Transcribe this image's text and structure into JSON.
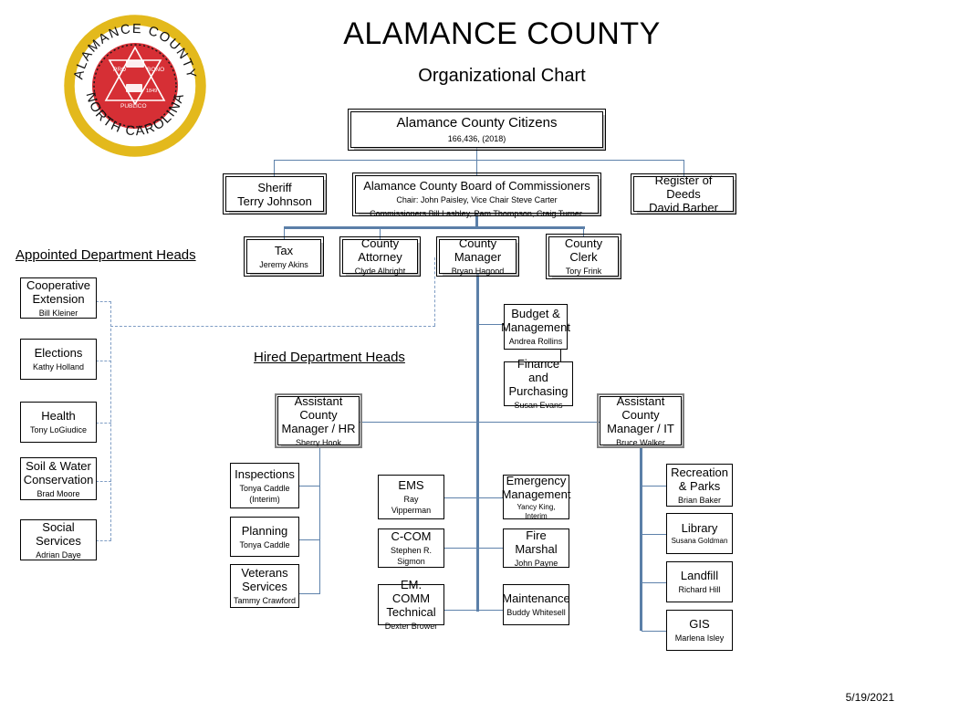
{
  "header": {
    "title": "ALAMANCE COUNTY",
    "subtitle": "Organizational Chart",
    "date": "5/19/2021"
  },
  "seal": {
    "name": "alamance-county-seal",
    "outer_top_text": "ALAMANCE  COUNTY",
    "outer_bottom_text": "NORTH  CAROLINA",
    "inner_left": "PRO",
    "inner_right": "BONO",
    "inner_bottom": "PUBLICO",
    "inner_year": "1849",
    "ring_color": "#F5D02B",
    "disc_color": "#D62F35"
  },
  "sections": {
    "appointed_label": "Appointed Department Heads",
    "hired_label": "Hired Department Heads"
  },
  "boxes": {
    "citizens": {
      "title": "Alamance County Citizens",
      "sub": "166,436, (2018)"
    },
    "sheriff": {
      "title": "Sheriff",
      "sub": "Terry Johnson"
    },
    "commissioners": {
      "title": "Alamance County Board of Commissioners",
      "sub": "Chair: John Paisley, Vice Chair Steve Carter",
      "sub2": "Commissioners Bill Lashley, Pam Thompson, Craig Turner."
    },
    "register_of_deeds": {
      "title": "Register of Deeds",
      "sub": "David Barber"
    },
    "tax": {
      "title": "Tax",
      "sub": "Jeremy Akins"
    },
    "county_attorney": {
      "title": "County Attorney",
      "sub": "Clyde Albright"
    },
    "county_manager": {
      "title": "County Manager",
      "sub": "Bryan Hagood"
    },
    "county_clerk": {
      "title": "County",
      "title2": "Clerk",
      "sub": "Tory Frink"
    },
    "cooperative_extension": {
      "title": "Cooperative",
      "title2": "Extension",
      "sub": "Bill Kleiner"
    },
    "elections": {
      "title": "Elections",
      "sub": "Kathy Holland"
    },
    "health": {
      "title": "Health",
      "sub": "Tony LoGiudice"
    },
    "soil_water": {
      "title": "Soil & Water",
      "title2": "Conservation",
      "sub": "Brad Moore"
    },
    "social_services": {
      "title": "Social Services",
      "sub": "Adrian Daye"
    },
    "budget_management": {
      "title": "Budget &",
      "title2": "Management",
      "sub": "Andrea Rollins"
    },
    "finance_purchasing": {
      "title": "Finance and",
      "title2": "Purchasing",
      "sub": "Susan Evans"
    },
    "acm_hr": {
      "title": "Assistant County",
      "title2": "Manager / HR",
      "sub": "Sherry Hook"
    },
    "acm_it": {
      "title": "Assistant County",
      "title2": "Manager / IT",
      "sub": "Bruce Walker"
    },
    "inspections": {
      "title": "Inspections",
      "sub": "Tonya Caddle",
      "sub2": "(Interim)"
    },
    "planning": {
      "title": "Planning",
      "sub": "Tonya Caddle"
    },
    "veterans_services": {
      "title": "Veterans",
      "title2": "Services",
      "sub": "Tammy Crawford"
    },
    "ems": {
      "title": "EMS",
      "sub": "Ray",
      "sub2": "Vipperman"
    },
    "ccom": {
      "title": "C-COM",
      "sub": "Stephen R. Sigmon"
    },
    "em_comm_technical": {
      "title": "EM. COMM",
      "title2": "Technical",
      "sub": "Dexter Brower"
    },
    "emergency_management": {
      "title": "Emergency",
      "title2": "Management",
      "sub": "Yancy King, Interim"
    },
    "fire_marshal": {
      "title": "Fire Marshal",
      "sub": "John Payne"
    },
    "maintenance": {
      "title": "Maintenance",
      "sub": "Buddy Whitesell"
    },
    "recreation_parks": {
      "title": "Recreation",
      "title2": "& Parks",
      "sub": "Brian Baker"
    },
    "library": {
      "title": "Library",
      "sub": "Susana Goldman"
    },
    "landfill": {
      "title": "Landfill",
      "sub": "Richard Hill"
    },
    "gis": {
      "title": "GIS",
      "sub": "Marlena  Isley"
    }
  },
  "colors": {
    "connector": "#5e82ab",
    "connector_thick": "#5b7fa8",
    "dashed": "#7f9dc4",
    "box_border": "#000000"
  }
}
